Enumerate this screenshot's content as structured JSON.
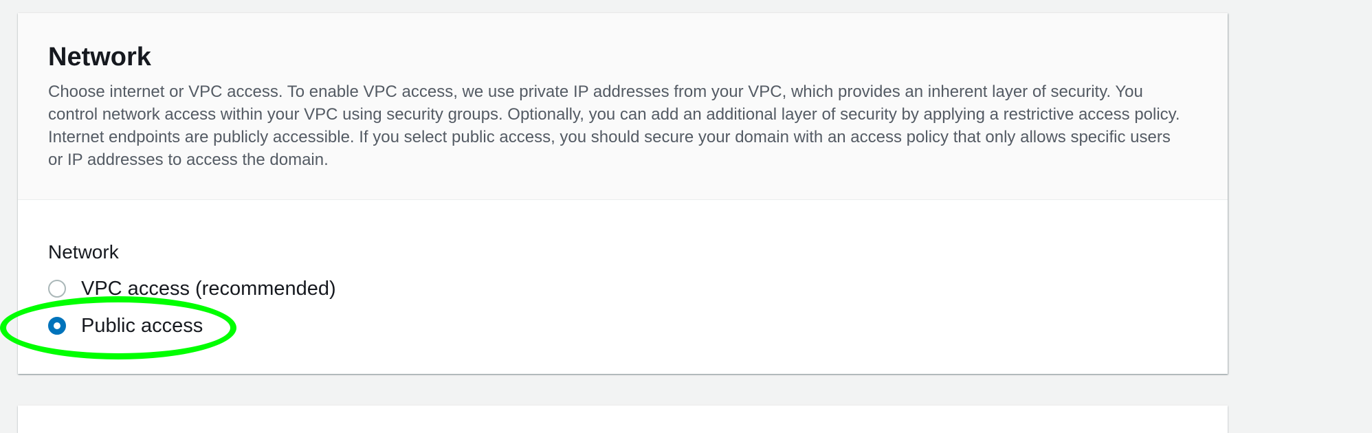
{
  "network_panel": {
    "title": "Network",
    "description": "Choose internet or VPC access. To enable VPC access, we use private IP addresses from your VPC, which provides an inherent layer of security. You control network access within your VPC using security groups. Optionally, you can add an additional layer of security by applying a restrictive access policy. Internet endpoints are publicly accessible. If you select public access, you should secure your domain with an access policy that only allows specific users or IP addresses to access the domain.",
    "field_label": "Network",
    "options": [
      {
        "label": "VPC access (recommended)",
        "selected": false
      },
      {
        "label": "Public access",
        "selected": true
      }
    ]
  },
  "colors": {
    "accent": "#0073bb",
    "highlight": "#00ff00"
  }
}
